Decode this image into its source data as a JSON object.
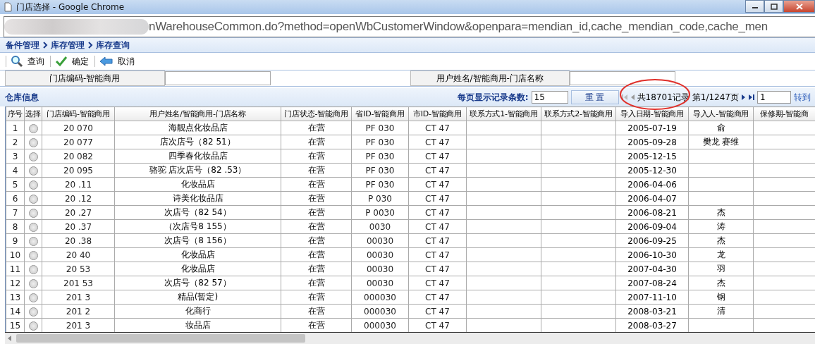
{
  "window": {
    "title": "门店选择 - Google Chrome"
  },
  "address_bar": {
    "url": "nWarehouseCommon.do?method=openWbCustomerWindow&openpara=mendian_id,cache_mendian_code,cache_men"
  },
  "breadcrumb": [
    "备件管理",
    "库存管理",
    "库存查询"
  ],
  "toolbar": [
    {
      "kind": "search",
      "label": "查询"
    },
    {
      "kind": "confirm",
      "label": "确定"
    },
    {
      "kind": "cancel",
      "label": "取消"
    }
  ],
  "filters": [
    {
      "label": "门店编码-智能商用"
    },
    {
      "label": "用户姓名/智能商用-门店名称"
    }
  ],
  "section": {
    "title": "仓库信息"
  },
  "pager": {
    "page_size_label": "每页显示记录条数:",
    "page_size": "15",
    "reset": "重 置",
    "total": "共18701记录",
    "page": "第1/1247页",
    "goto_value": "1",
    "goto": "转到"
  },
  "table": {
    "columns": [
      "序号",
      "选择",
      "门店编码-智能商用",
      "用户姓名/智能商用-门店名称",
      "门店状态-智能商用",
      "省ID-智能商用",
      "市ID-智能商用",
      "联系方式1-智能商用",
      "联系方式2-智能商用",
      "导入日期-智能商用",
      "导入人-智能商用",
      "保修期-智能商"
    ],
    "rows": [
      {
        "no": "1",
        "selected": false,
        "code": "20 070",
        "name": "海靓点化妆品店",
        "status": "在营",
        "province": "PF 030",
        "city": "CT 47",
        "date": "2005-07-19",
        "importer": "俞"
      },
      {
        "no": "2",
        "selected": false,
        "code": "20 077",
        "name": "店次店号（82 51）",
        "status": "在营",
        "province": "PF 030",
        "city": "CT 47",
        "date": "2005-09-28",
        "importer": "樊龙 赛维"
      },
      {
        "no": "3",
        "selected": false,
        "code": "20 082",
        "name": "四季春化妆品店",
        "status": "在营",
        "province": "PF 030",
        "city": "CT 47",
        "date": "2005-12-15"
      },
      {
        "no": "4",
        "selected": false,
        "code": "20 095",
        "name": "骆驼 店次店号（82 .53）",
        "status": "在营",
        "province": "PF 030",
        "city": "CT 47",
        "date": "2005-12-30"
      },
      {
        "no": "5",
        "selected": false,
        "code": "20 .11",
        "name": "化妆品店",
        "status": "在营",
        "province": "PF 030",
        "city": "CT 47",
        "date": "2006-04-06"
      },
      {
        "no": "6",
        "selected": false,
        "code": "20 .12",
        "name": "诗美化妆品店",
        "status": "在营",
        "province": "P 030",
        "city": "CT 47",
        "date": "2006-04-07"
      },
      {
        "no": "7",
        "selected": false,
        "code": "20 .27",
        "name": "次店号（82 54）",
        "status": "在营",
        "province": "P 0030",
        "city": "CT 47",
        "date": "2006-08-21",
        "importer": "杰"
      },
      {
        "no": "8",
        "selected": false,
        "code": "20 .37",
        "name": "（次店号8 155）",
        "status": "在营",
        "province": "0030",
        "city": "CT 47",
        "date": "2006-09-04",
        "importer": "涛"
      },
      {
        "no": "9",
        "selected": false,
        "code": "20 .38",
        "name": "次店号（8 156）",
        "status": "在营",
        "province": "00030",
        "city": "CT 47",
        "date": "2006-09-25",
        "importer": "杰"
      },
      {
        "no": "10",
        "selected": false,
        "code": "20 40",
        "name": "化妆品店",
        "status": "在营",
        "province": "00030",
        "city": "CT 47",
        "date": "2006-10-30",
        "importer": "龙"
      },
      {
        "no": "11",
        "selected": false,
        "code": "20 53",
        "name": "化妆品店",
        "status": "在营",
        "province": "00030",
        "city": "CT 47",
        "date": "2007-04-30",
        "importer": "羽"
      },
      {
        "no": "12",
        "selected": false,
        "code": "201 53",
        "name": "次店号（82 57）",
        "status": "在营",
        "province": "00030",
        "city": "CT 47",
        "date": "2007-08-24",
        "importer": "杰"
      },
      {
        "no": "13",
        "selected": false,
        "code": "201 3",
        "name": "精品(暂定)",
        "status": "在营",
        "province": "000030",
        "city": "CT 47",
        "date": "2007-11-10",
        "importer": "钢"
      },
      {
        "no": "14",
        "selected": false,
        "code": "201 2",
        "name": "化商行",
        "status": "在营",
        "province": "000030",
        "city": "CT 47",
        "date": "2008-03-21",
        "importer": "清"
      },
      {
        "no": "15",
        "selected": false,
        "code": "201 3",
        "name": "妆品店",
        "status": "在营",
        "province": "000030",
        "city": "CT 47",
        "date": "2008-03-27"
      }
    ]
  }
}
